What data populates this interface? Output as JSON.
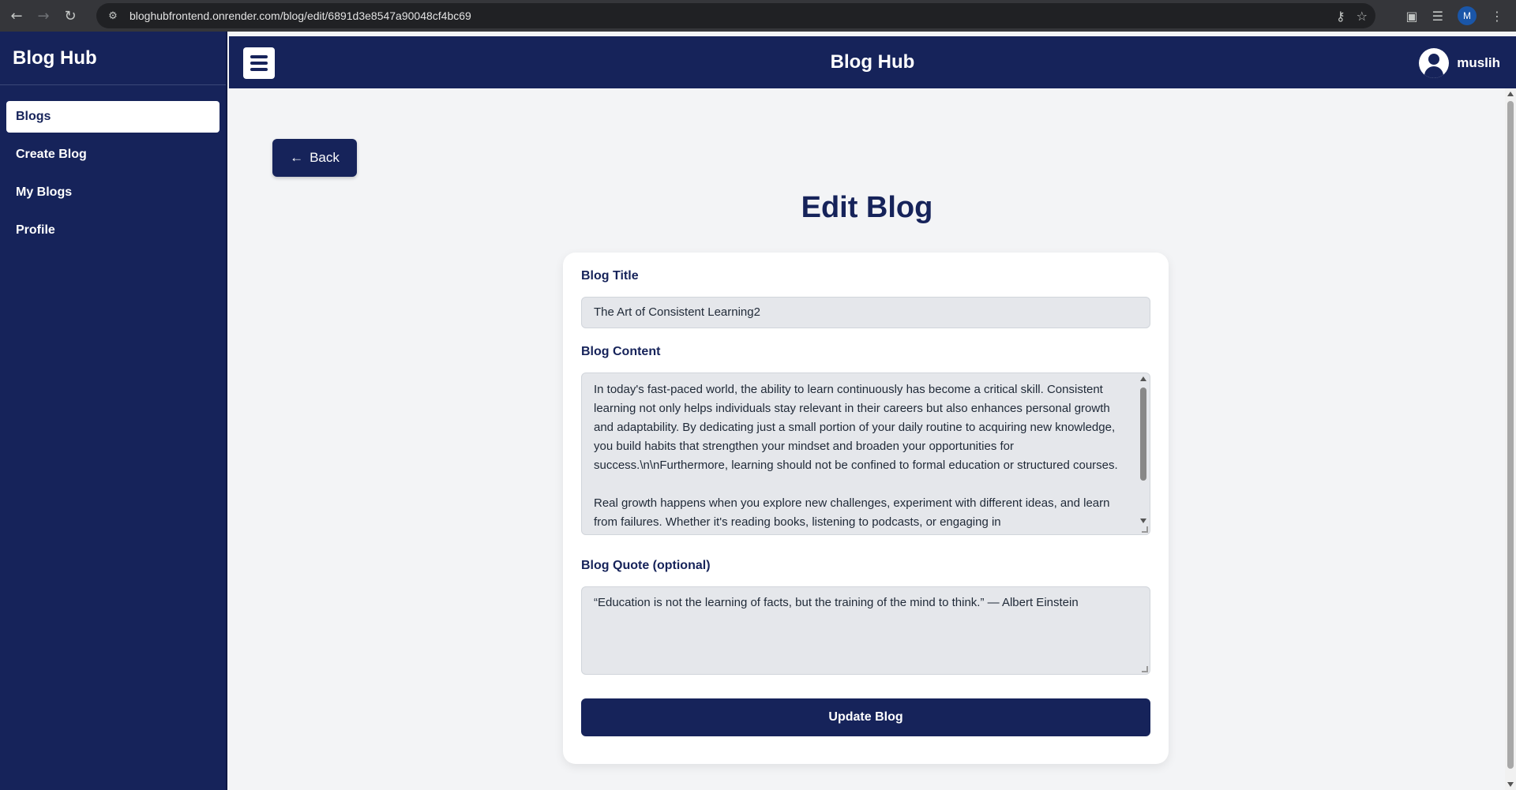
{
  "browser": {
    "url": "bloghubfrontend.onrender.com/blog/edit/6891d3e8547a90048cf4bc69",
    "profile_initial": "M"
  },
  "sidebar": {
    "brand": "Blog Hub",
    "items": [
      {
        "label": "Blogs",
        "active": true
      },
      {
        "label": "Create Blog",
        "active": false
      },
      {
        "label": "My Blogs",
        "active": false
      },
      {
        "label": "Profile",
        "active": false
      }
    ]
  },
  "header": {
    "title": "Blog Hub",
    "username": "muslih"
  },
  "main": {
    "back_label": "Back",
    "page_title": "Edit Blog",
    "form": {
      "title_label": "Blog Title",
      "title_value": "The Art of Consistent Learning2",
      "content_label": "Blog Content",
      "content_value": "In today's fast-paced world, the ability to learn continuously has become a critical skill. Consistent learning not only helps individuals stay relevant in their careers but also enhances personal growth and adaptability. By dedicating just a small portion of your daily routine to acquiring new knowledge, you build habits that strengthen your mindset and broaden your opportunities for success.\\n\\nFurthermore, learning should not be confined to formal education or structured courses.\n\nReal growth happens when you explore new challenges, experiment with different ideas, and learn from failures. Whether it's reading books, listening to podcasts, or engaging in",
      "quote_label": "Blog Quote (optional)",
      "quote_value": "“Education is not the learning of facts, but the training of the mind to think.” — Albert Einstein",
      "submit_label": "Update Blog"
    }
  },
  "colors": {
    "navy": "#16235a",
    "page_bg": "#f3f4f6",
    "input_bg": "#e5e7eb"
  }
}
